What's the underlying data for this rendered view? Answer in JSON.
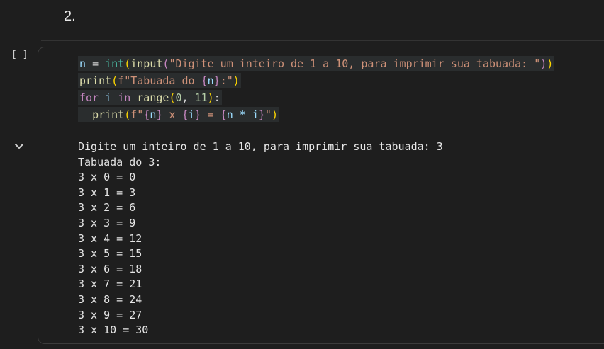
{
  "markdown": {
    "heading": "2."
  },
  "cell": {
    "exec_count": "[ ]",
    "code_lines": [
      [
        "n",
        " ",
        "=",
        " ",
        "int",
        "(",
        "input",
        "(",
        "\"Digite um inteiro de 1 a 10, para imprimir sua tabuada: \"",
        ")",
        ")"
      ],
      [
        "print",
        "(",
        "f\"Tabuada do ",
        "{",
        "n",
        "}",
        ":\"",
        ")"
      ],
      [
        "for",
        " ",
        "i",
        " ",
        "in",
        " ",
        "range",
        "(",
        "0",
        ", ",
        "11",
        ")",
        ":"
      ],
      [
        "  ",
        "print",
        "(",
        "f\"",
        "{",
        "n",
        "}",
        " x ",
        "{",
        "i",
        "}",
        " = ",
        "{",
        "n * i",
        "}",
        "\"",
        ")"
      ]
    ],
    "output_lines": [
      "Digite um inteiro de 1 a 10, para imprimir sua tabuada: 3",
      "Tabuada do 3:",
      "3 x 0 = 0",
      "3 x 1 = 3",
      "3 x 2 = 6",
      "3 x 3 = 9",
      "3 x 4 = 12",
      "3 x 5 = 15",
      "3 x 6 = 18",
      "3 x 7 = 21",
      "3 x 8 = 24",
      "3 x 9 = 27",
      "3 x 10 = 30"
    ]
  },
  "icons": {
    "collapse": "chevron-down-icon"
  },
  "colors": {
    "background": "#1e1e1e",
    "keyword": "#c586c0",
    "function": "#dcdcaa",
    "builtin": "#4ec9b0",
    "string": "#ce9178",
    "number": "#b5cea8",
    "variable": "#9cdcfe",
    "bracket": "#ffd700"
  }
}
